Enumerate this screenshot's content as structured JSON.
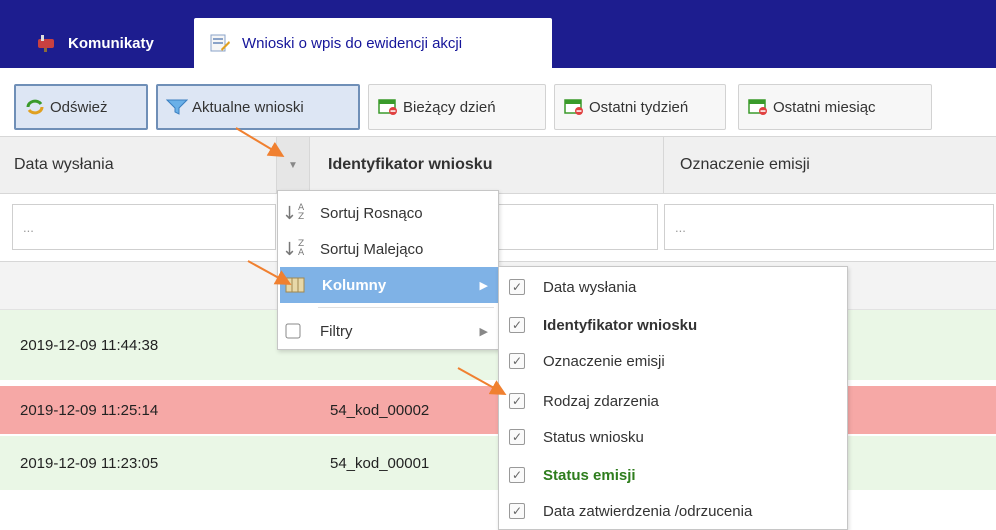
{
  "tabs": [
    {
      "label": "Komunikaty",
      "icon": "mailbox-icon",
      "active": false
    },
    {
      "label": "Wnioski o wpis do ewidencji akcji",
      "icon": "document-edit-icon",
      "active": true
    }
  ],
  "toolbar": {
    "refresh": "Odśwież",
    "current": "Aktualne wnioski",
    "today": "Bieżący dzień",
    "last_week": "Ostatni tydzień",
    "last_month": "Ostatni miesiąc"
  },
  "grid": {
    "headers": [
      "Data wysłania",
      "Identyfikator wniosku",
      "Oznaczenie emisji"
    ],
    "filters": [
      "...",
      "",
      "..."
    ],
    "rows": [
      {
        "date": "2019-12-09 11:44:38",
        "id": "",
        "status": "ok"
      },
      {
        "date": "2019-12-09 11:25:14",
        "id": "54_kod_00002",
        "status": "error"
      },
      {
        "date": "2019-12-09 11:23:05",
        "id": "54_kod_00001",
        "status": "ok"
      }
    ]
  },
  "menu": {
    "sort_asc": "Sortuj Rosnąco",
    "sort_desc": "Sortuj Malejąco",
    "columns": "Kolumny",
    "filters": "Filtry"
  },
  "columns_menu": [
    {
      "label": "Data wysłania",
      "checked": true
    },
    {
      "label": "Identyfikator wniosku",
      "checked": true
    },
    {
      "label": "Oznaczenie emisji",
      "checked": true
    },
    {
      "label": "Rodzaj zdarzenia",
      "checked": true
    },
    {
      "label": "Status wniosku",
      "checked": true
    },
    {
      "label": "Status emisji",
      "checked": true
    },
    {
      "label": "Data zatwierdzenia /odrzucenia",
      "checked": true
    }
  ],
  "colors": {
    "tabbar": "#1d1d8f",
    "row_ok": "#eaf7e6",
    "row_error": "#f6a8a6",
    "menu_highlight": "#7fb2e6",
    "annotation_arrow": "#f08030",
    "status_emisji": "#2e7d1d"
  }
}
